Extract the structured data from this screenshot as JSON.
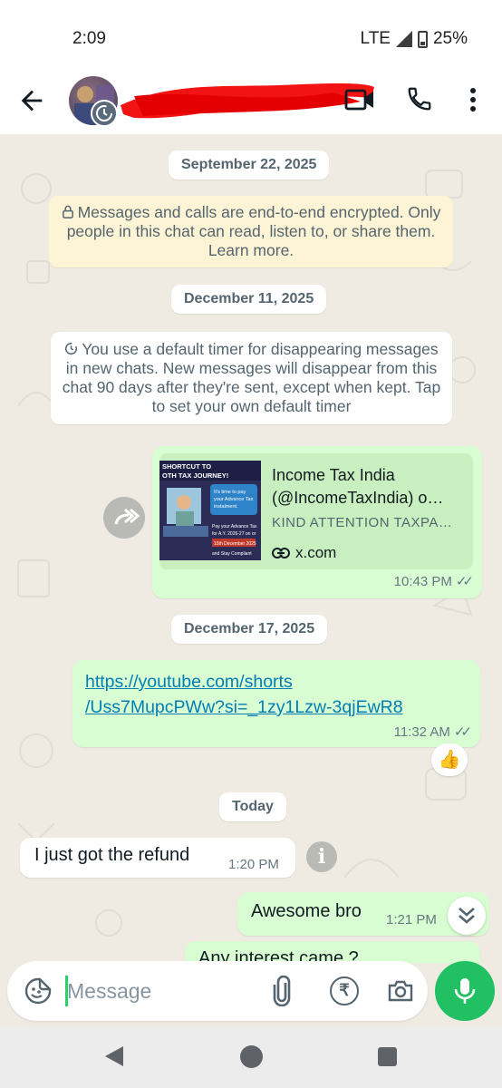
{
  "status_bar": {
    "time": "2:09",
    "network": "LTE",
    "battery": "25%"
  },
  "header": {
    "contact_name": ""
  },
  "chat": {
    "date_1": "September 22, 2025",
    "encryption_notice": "Messages and calls are end-to-end encrypted. Only people in this chat can read, listen to, or share them. Learn more.",
    "date_2": "December 11, 2025",
    "timer_notice": "You use a default timer for disappearing messages in new chats. New messages will disappear from this chat 90 days after they're sent, except when kept. Tap to set your own default timer",
    "link_message": {
      "title": "Income Tax India (@IncomeTaxIndia) o…",
      "description": "KIND ATTENTION TAXPA…",
      "domain": "x.com",
      "time": "10:43 PM",
      "thumbnail_text": "SHORTCUT TO\nOTH TAX JOURNEY!\nIt's time to pay your Advance Tax instalment.\nPay your Advance Tax for A.Y. 2026-27 on or before\n15th December 2025\nand Stay Compliant"
    },
    "date_3": "December 17, 2025",
    "youtube_message": {
      "link_line_1": "https://youtube.com/shorts",
      "link_line_2": "/Uss7MupcPWw?si=_1zy1Lzw-3qjEwR8",
      "time": "11:32 AM",
      "reaction": "👍"
    },
    "date_4": "Today",
    "incoming_message": {
      "text": "I just got the refund",
      "time": "1:20 PM"
    },
    "outgoing_message": {
      "text": "Awesome bro",
      "time": "1:21 PM"
    },
    "partial_message": {
      "text": "Any interest came ?"
    }
  },
  "composer": {
    "placeholder": "Message"
  },
  "colors": {
    "outgoing_bubble": "#d9fdd3",
    "wallpaper": "#efeae2",
    "accent_green": "#21c063",
    "link": "#027eb5"
  }
}
